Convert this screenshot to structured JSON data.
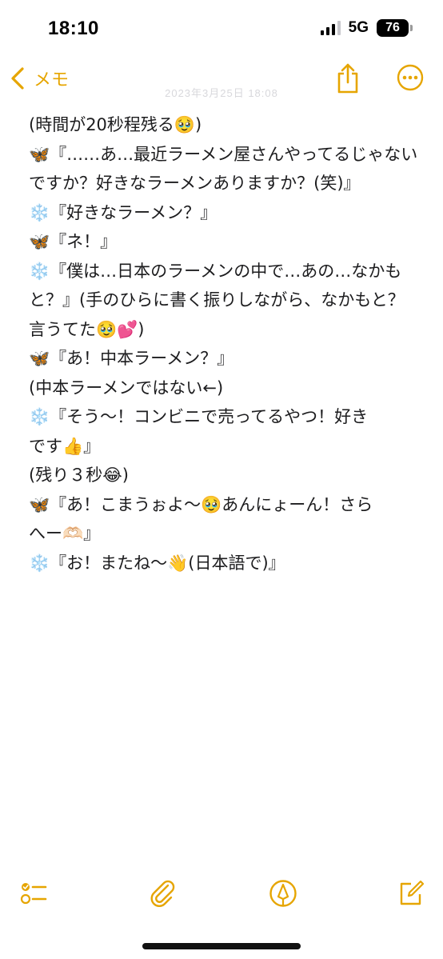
{
  "status_bar": {
    "time": "18:10",
    "network": "5G",
    "battery": "76"
  },
  "nav": {
    "back_label": "メモ",
    "faded_date": "2023年3月25日 18:08",
    "accent_color": "#e6a500"
  },
  "note": {
    "lines": [
      "(時間が20秒程残る🥹)",
      "🦋『……あ…最近ラーメン屋さんやってるじゃない",
      "ですか？好きなラーメンありますか？(笑)』",
      "❄️『好きなラーメン？』",
      "🦋『ネ！』",
      "❄️『僕は…日本のラーメンの中で…あの…なかも",
      "と？』(手のひらに書く振りしながら、なかもと？",
      "言うてた🥹💕)",
      "🦋『あ！中本ラーメン？』",
      "(中本ラーメンではない←)",
      "❄️『そう〜！コンビニで売ってるやつ！好き",
      "です👍』",
      "(残り３秒😂)",
      "🦋『あ！こまうぉよ〜🥹あんにょーん！さら",
      "へー🫶🏻』",
      "❄️『お！またね〜👋(日本語で)』"
    ]
  },
  "toolbar": {
    "icons": [
      "checklist-icon",
      "paperclip-icon",
      "markup-pen-icon",
      "compose-icon"
    ]
  }
}
